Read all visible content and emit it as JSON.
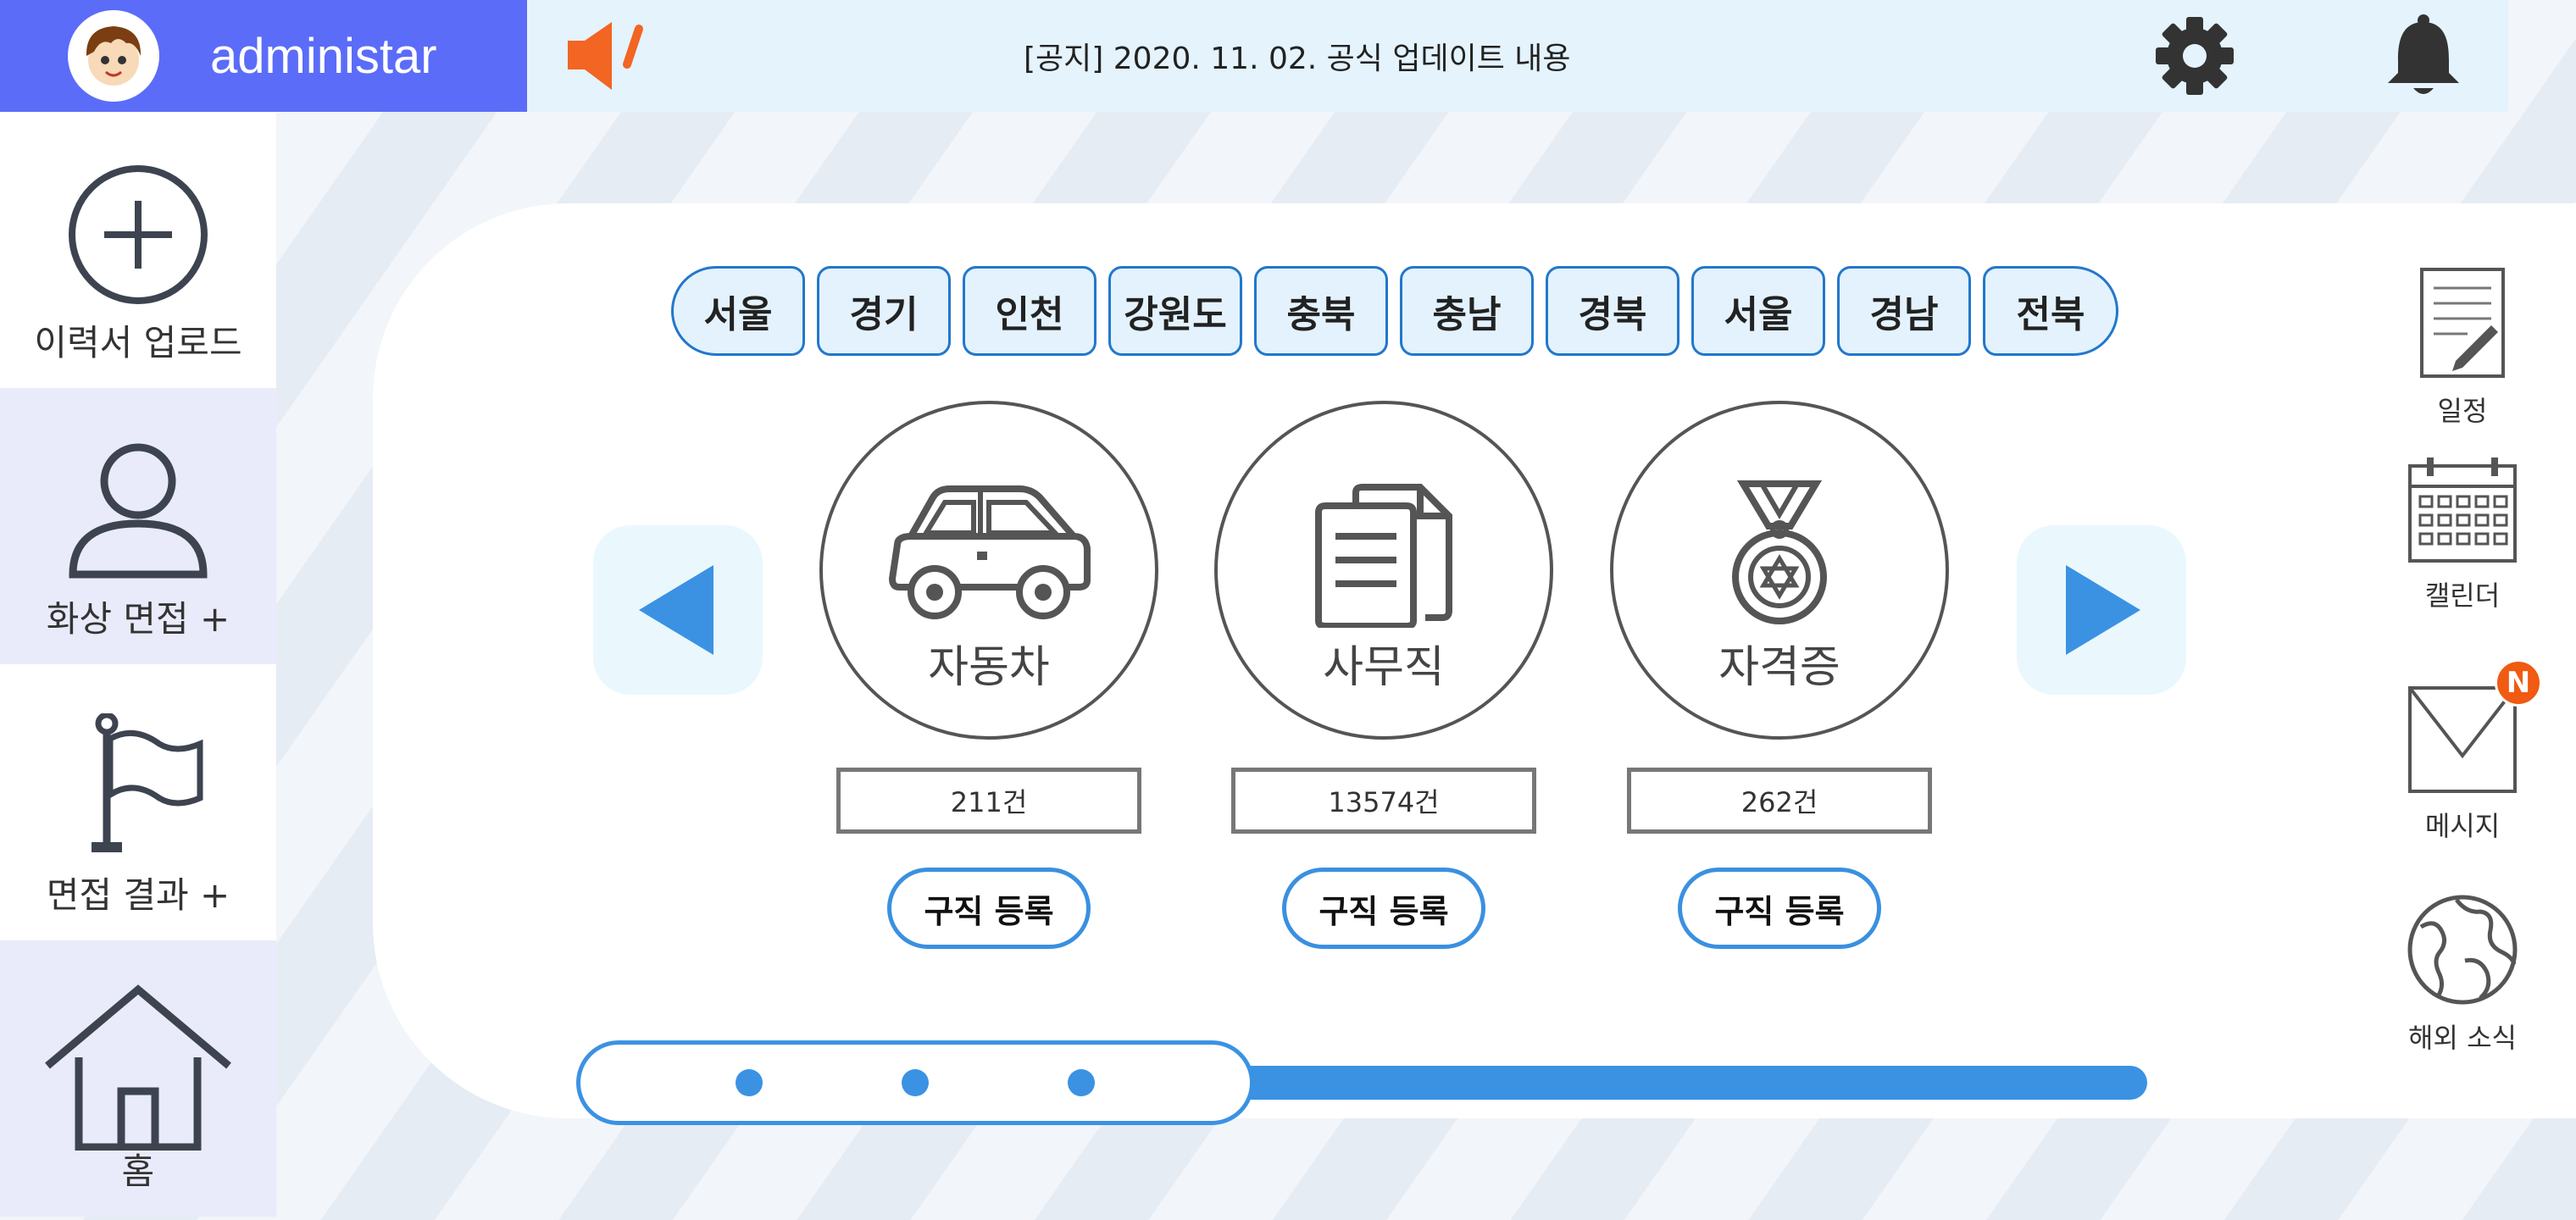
{
  "header": {
    "username": "administar",
    "notice": "[공지] 2020. 11. 02. 공식 업데이트 내용"
  },
  "sidebar": {
    "items": [
      {
        "label": "이력서 업로드",
        "icon": "plus-circle-icon"
      },
      {
        "label": "화상 면접 +",
        "icon": "person-icon"
      },
      {
        "label": "면접 결과 +",
        "icon": "flag-icon"
      },
      {
        "label": "홈",
        "icon": "home-icon"
      }
    ]
  },
  "regions": [
    "서울",
    "경기",
    "인천",
    "강원도",
    "충북",
    "충남",
    "경북",
    "서울",
    "경남",
    "전북"
  ],
  "categories": [
    {
      "label": "자동차",
      "count": "211건",
      "button": "구직 등록",
      "icon": "car-icon"
    },
    {
      "label": "사무직",
      "count": "13574건",
      "button": "구직 등록",
      "icon": "documents-icon"
    },
    {
      "label": "자격증",
      "count": "262건",
      "button": "구직 등록",
      "icon": "medal-icon"
    }
  ],
  "right_rail": {
    "items": [
      {
        "label": "일정",
        "icon": "schedule-note-icon"
      },
      {
        "label": "캘린더",
        "icon": "calendar-icon"
      },
      {
        "label": "메시지",
        "icon": "envelope-icon",
        "badge": "N"
      },
      {
        "label": "해외 소식",
        "icon": "globe-icon"
      }
    ]
  },
  "carousel": {
    "page_dots": 3
  },
  "colors": {
    "user_box": "#5b6cf8",
    "notice_bar": "#e4f3fc",
    "accent_blue": "#3b92e3",
    "speaker_orange": "#f26522",
    "badge_orange": "#f05a12"
  }
}
